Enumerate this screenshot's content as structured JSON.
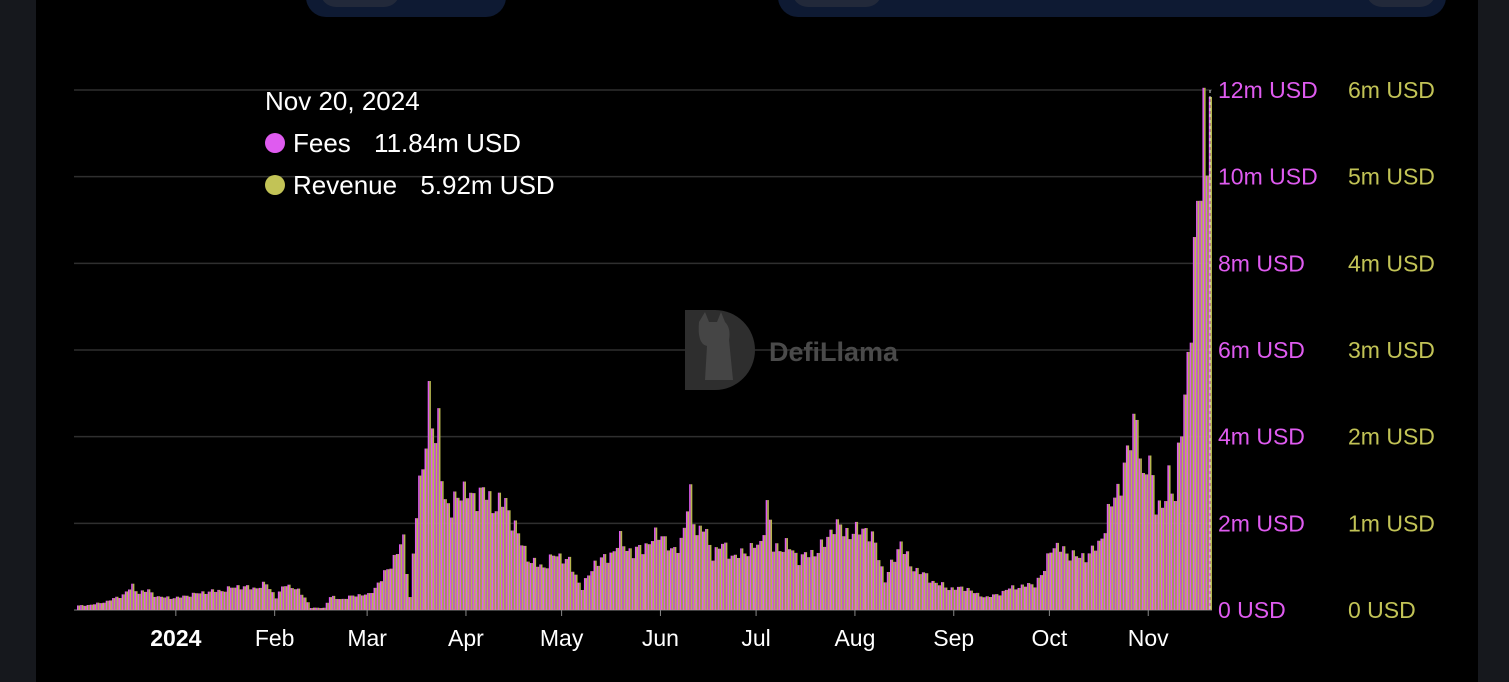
{
  "colors": {
    "fees": "#df5bf0",
    "revenue": "#b7b84e",
    "grid": "#2f2f2f",
    "background": "#000000",
    "watermark": "#4a4a4a"
  },
  "watermark": {
    "text": "DefiLlama",
    "icon": "defillama-logo-icon"
  },
  "tooltip": {
    "date": "Nov 20, 2024",
    "rows": [
      {
        "label": "Fees",
        "value": "11.84m USD",
        "color": "#df5bf0"
      },
      {
        "label": "Revenue",
        "value": "5.92m USD",
        "color": "#c2c356"
      }
    ]
  },
  "chart_data": {
    "type": "bar",
    "x_start": "2023-12-01",
    "x_end": "2024-11-20",
    "x_ticks": [
      "2024",
      "Feb",
      "Mar",
      "Apr",
      "May",
      "Jun",
      "Jul",
      "Aug",
      "Sep",
      "Oct",
      "Nov"
    ],
    "y_left": {
      "min": 0,
      "max": 12,
      "ticks": [
        "0 USD",
        "2m USD",
        "4m USD",
        "6m USD",
        "8m USD",
        "10m USD",
        "12m USD"
      ]
    },
    "y_right": {
      "min": 0,
      "max": 6,
      "ticks": [
        "0 USD",
        "1m USD",
        "2m USD",
        "3m USD",
        "4m USD",
        "5m USD",
        "6m USD"
      ]
    },
    "grid": true,
    "series": [
      {
        "name": "Fees",
        "axis": "left",
        "unit": "m USD",
        "anchors": [
          [
            "2023-12-01",
            0.1
          ],
          [
            "2023-12-05",
            0.12
          ],
          [
            "2023-12-10",
            0.2
          ],
          [
            "2023-12-15",
            0.35
          ],
          [
            "2023-12-18",
            0.55
          ],
          [
            "2023-12-20",
            0.4
          ],
          [
            "2023-12-23",
            0.45
          ],
          [
            "2023-12-26",
            0.3
          ],
          [
            "2024-01-01",
            0.28
          ],
          [
            "2024-01-05",
            0.35
          ],
          [
            "2024-01-10",
            0.42
          ],
          [
            "2024-01-15",
            0.45
          ],
          [
            "2024-01-20",
            0.55
          ],
          [
            "2024-01-25",
            0.5
          ],
          [
            "2024-01-29",
            0.6
          ],
          [
            "2024-02-01",
            0.3
          ],
          [
            "2024-02-04",
            0.6
          ],
          [
            "2024-02-07",
            0.5
          ],
          [
            "2024-02-10",
            0.3
          ],
          [
            "2024-02-12",
            0.05
          ],
          [
            "2024-02-16",
            0.05
          ],
          [
            "2024-02-18",
            0.3
          ],
          [
            "2024-02-22",
            0.25
          ],
          [
            "2024-02-26",
            0.35
          ],
          [
            "2024-03-01",
            0.35
          ],
          [
            "2024-03-05",
            0.7
          ],
          [
            "2024-03-09",
            1.2
          ],
          [
            "2024-03-12",
            1.6
          ],
          [
            "2024-03-14",
            0.3
          ],
          [
            "2024-03-16",
            2.2
          ],
          [
            "2024-03-18",
            3.4
          ],
          [
            "2024-03-20",
            4.9
          ],
          [
            "2024-03-22",
            3.7
          ],
          [
            "2024-03-23",
            4.4
          ],
          [
            "2024-03-25",
            2.5
          ],
          [
            "2024-03-27",
            2.2
          ],
          [
            "2024-03-29",
            2.8
          ],
          [
            "2024-04-02",
            2.6
          ],
          [
            "2024-04-06",
            2.7
          ],
          [
            "2024-04-10",
            2.4
          ],
          [
            "2024-04-13",
            2.5
          ],
          [
            "2024-04-17",
            1.7
          ],
          [
            "2024-04-21",
            1.1
          ],
          [
            "2024-04-25",
            1.0
          ],
          [
            "2024-04-29",
            1.3
          ],
          [
            "2024-05-03",
            1.1
          ],
          [
            "2024-05-07",
            0.5
          ],
          [
            "2024-05-11",
            1.1
          ],
          [
            "2024-05-15",
            1.2
          ],
          [
            "2024-05-19",
            1.6
          ],
          [
            "2024-05-23",
            1.3
          ],
          [
            "2024-05-27",
            1.5
          ],
          [
            "2024-06-01",
            1.8
          ],
          [
            "2024-06-04",
            1.3
          ],
          [
            "2024-06-07",
            1.6
          ],
          [
            "2024-06-10",
            2.6
          ],
          [
            "2024-06-12",
            1.8
          ],
          [
            "2024-06-14",
            1.9
          ],
          [
            "2024-06-17",
            1.3
          ],
          [
            "2024-06-20",
            1.5
          ],
          [
            "2024-06-24",
            1.2
          ],
          [
            "2024-06-28",
            1.4
          ],
          [
            "2024-07-02",
            1.5
          ],
          [
            "2024-07-04",
            2.5
          ],
          [
            "2024-07-06",
            1.4
          ],
          [
            "2024-07-10",
            1.5
          ],
          [
            "2024-07-14",
            1.2
          ],
          [
            "2024-07-18",
            1.3
          ],
          [
            "2024-07-22",
            1.5
          ],
          [
            "2024-07-25",
            2.0
          ],
          [
            "2024-07-28",
            1.8
          ],
          [
            "2024-08-01",
            1.8
          ],
          [
            "2024-08-04",
            1.9
          ],
          [
            "2024-08-07",
            1.5
          ],
          [
            "2024-08-10",
            0.7
          ],
          [
            "2024-08-13",
            1.2
          ],
          [
            "2024-08-15",
            1.6
          ],
          [
            "2024-08-18",
            1.0
          ],
          [
            "2024-08-21",
            0.9
          ],
          [
            "2024-08-24",
            0.7
          ],
          [
            "2024-08-27",
            0.6
          ],
          [
            "2024-08-30",
            0.5
          ],
          [
            "2024-09-02",
            0.5
          ],
          [
            "2024-09-05",
            0.5
          ],
          [
            "2024-09-08",
            0.35
          ],
          [
            "2024-09-11",
            0.3
          ],
          [
            "2024-09-14",
            0.35
          ],
          [
            "2024-09-18",
            0.5
          ],
          [
            "2024-09-22",
            0.55
          ],
          [
            "2024-09-26",
            0.6
          ],
          [
            "2024-09-29",
            0.9
          ],
          [
            "2024-10-01",
            1.5
          ],
          [
            "2024-10-04",
            1.4
          ],
          [
            "2024-10-07",
            1.3
          ],
          [
            "2024-10-10",
            1.2
          ],
          [
            "2024-10-13",
            1.3
          ],
          [
            "2024-10-16",
            1.5
          ],
          [
            "2024-10-19",
            2.2
          ],
          [
            "2024-10-22",
            2.8
          ],
          [
            "2024-10-25",
            3.5
          ],
          [
            "2024-10-28",
            4.7
          ],
          [
            "2024-10-30",
            2.8
          ],
          [
            "2024-11-01",
            3.6
          ],
          [
            "2024-11-03",
            2.5
          ],
          [
            "2024-11-05",
            2.2
          ],
          [
            "2024-11-07",
            3.2
          ],
          [
            "2024-11-09",
            2.6
          ],
          [
            "2024-11-11",
            4.2
          ],
          [
            "2024-11-13",
            5.9
          ],
          [
            "2024-11-15",
            7.8
          ],
          [
            "2024-11-16",
            9.0
          ],
          [
            "2024-11-18",
            11.6
          ],
          [
            "2024-11-19",
            10.8
          ],
          [
            "2024-11-20",
            11.84
          ]
        ]
      },
      {
        "name": "Revenue",
        "axis": "right",
        "unit": "m USD",
        "ratio_to_fees": 0.5
      }
    ]
  }
}
